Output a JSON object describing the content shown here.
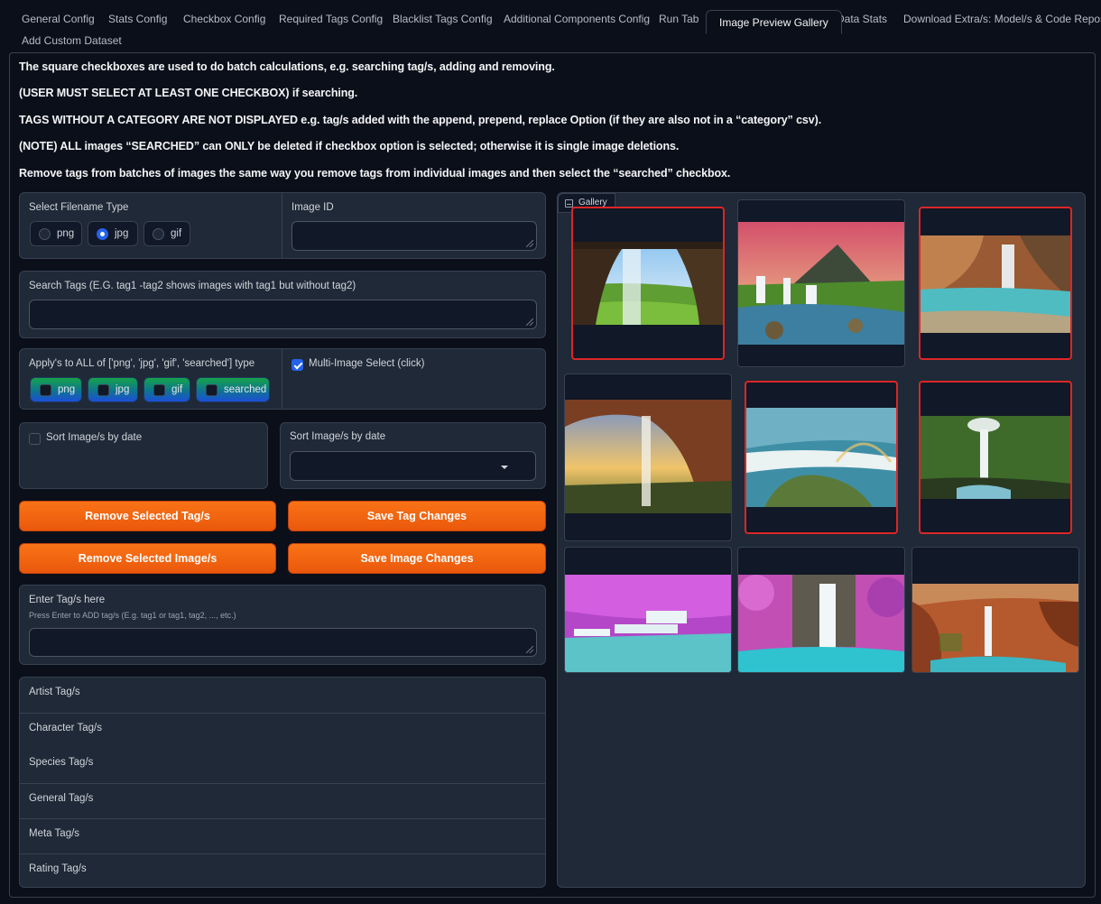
{
  "tabs": [
    {
      "label": "General Config"
    },
    {
      "label": "Stats Config"
    },
    {
      "label": "Checkbox Config"
    },
    {
      "label": "Required Tags Config"
    },
    {
      "label": "Blacklist Tags Config"
    },
    {
      "label": "Additional Components Config"
    },
    {
      "label": "Run Tab"
    },
    {
      "label": "Image Preview Gallery",
      "active": true
    },
    {
      "label": "Data Stats"
    },
    {
      "label": "Download Extra/s: Model/s & Code Repos"
    },
    {
      "label": "Add Custom Dataset"
    }
  ],
  "notes": [
    "The square checkboxes are used to do batch calculations, e.g. searching tag/s, adding and removing.",
    "(USER MUST SELECT AT LEAST ONE CHECKBOX) if searching.",
    "TAGS WITHOUT A CATEGORY ARE NOT DISPLAYED e.g. tag/s added with the append, prepend, replace Option (if they are also not in a “category” csv).",
    "(NOTE) ALL images “SEARCHED” can ONLY be deleted if checkbox option is selected; otherwise it is single image deletions.",
    "Remove tags from batches of images the same way you remove tags from individual images and then select the “searched” checkbox."
  ],
  "filename_type": {
    "label": "Select Filename Type",
    "options": [
      "png",
      "jpg",
      "gif"
    ],
    "selected": "jpg"
  },
  "image_id": {
    "label": "Image ID",
    "value": ""
  },
  "search_tags": {
    "label": "Search Tags (E.G. tag1 -tag2 shows images with tag1 but without tag2)",
    "value": ""
  },
  "apply_all": {
    "label": "Apply's to ALL of ['png', 'jpg', 'gif', 'searched'] type",
    "options": [
      "png",
      "jpg",
      "gif",
      "searched"
    ]
  },
  "multi_select": {
    "label": "Multi-Image Select (click)",
    "checked": true
  },
  "sort_checkbox": {
    "label": "Sort Image/s by date",
    "checked": false
  },
  "sort_dropdown": {
    "label": "Sort Image/s by date",
    "value": ""
  },
  "buttons": {
    "remove_tags": "Remove Selected Tag/s",
    "save_tags": "Save Tag Changes",
    "remove_images": "Remove Selected Image/s",
    "save_images": "Save Image Changes"
  },
  "enter_tags": {
    "label": "Enter Tag/s here",
    "hint": "Press Enter to ADD tag/s (E.g. tag1 or tag1, tag2, ..., etc.)",
    "value": ""
  },
  "tag_categories": [
    "Artist Tag/s",
    "Character Tag/s",
    "Species Tag/s",
    "General Tag/s",
    "Meta Tag/s",
    "Rating Tag/s"
  ],
  "gallery": {
    "label": "Gallery",
    "images": [
      {
        "name": "waterfall-cave-green-valley",
        "selected": true
      },
      {
        "name": "waterfall-mountain-sunset",
        "selected": false
      },
      {
        "name": "waterfall-canyon-turquoise-pool",
        "selected": true
      },
      {
        "name": "waterfall-cave-sunset",
        "selected": false
      },
      {
        "name": "aerial-waterfalls-rainbow",
        "selected": true
      },
      {
        "name": "waterfall-green-cave",
        "selected": true
      },
      {
        "name": "pink-forest-cascades",
        "selected": false
      },
      {
        "name": "pink-forest-waterfall",
        "selected": false
      },
      {
        "name": "red-canyon-waterfall",
        "selected": false
      }
    ]
  },
  "colors": {
    "accent_orange": "#f97316",
    "selected_border": "#dc2626",
    "checkbox_blue": "#2563eb",
    "panel_bg": "#1f2937",
    "page_bg": "#0b0f19"
  }
}
